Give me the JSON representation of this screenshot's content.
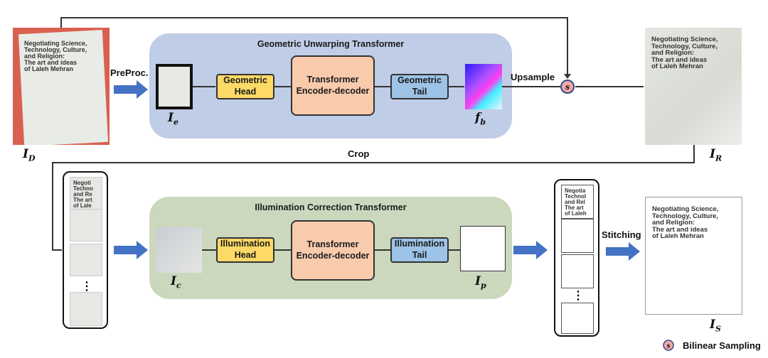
{
  "figure": {
    "geometric_panel": {
      "title": "Geometric Unwarping Transformer",
      "head": "Geometric\nHead",
      "encoder": "Transformer\nEncoder-decoder",
      "tail": "Geometric\nTail",
      "input_label": "I",
      "input_sub": "e",
      "output_label": "f",
      "output_sub": "b",
      "color": "#c0cde6"
    },
    "illumination_panel": {
      "title": "Illumination Correction Transformer",
      "head": "Illumination\nHead",
      "encoder": "Transformer\nEncoder-decoder",
      "tail": "Illumination\nTail",
      "input_label": "I",
      "input_sub": "c",
      "output_label": "I",
      "output_sub": "p",
      "color": "#cbd8be"
    },
    "steps": {
      "preproc": "PreProc.",
      "upsample": "Upsample",
      "crop": "Crop",
      "stitching": "Stitching"
    },
    "images": {
      "distorted": {
        "label": "I",
        "sub": "D",
        "title": "Negotiating Science,\nTechnology, Culture,\nand Religion:\nThe art and ideas\nof Laleh Mehran"
      },
      "rectified": {
        "label": "I",
        "sub": "R",
        "title": "Negotiating Science,\nTechnology, Culture,\nand Religion:\nThe art and ideas\nof Laleh Mehran"
      },
      "stitched": {
        "label": "I",
        "sub": "S",
        "title": "Negotiating Science,\nTechnology, Culture,\nand Religion:\nThe art and ideas\nof Laleh Mehran"
      },
      "crop_tile_title": "Negoti\nTechno\nand Re\nThe art\nof Lale",
      "out_tile_title": "Negotia\nTechnol\nand Rel\nThe art\nof Laleh"
    },
    "sampler": {
      "symbol": "s",
      "fill": "#f4a7a7",
      "stroke": "#2e4e8a"
    },
    "legend": {
      "symbol": "s",
      "text": "Bilinear Sampling"
    },
    "ellipsis": "⋮",
    "arrow_color": "#4472c4",
    "block_colors": {
      "head": "#fdd966",
      "encoder": "#f8cbad",
      "tail": "#9dc3e6"
    }
  }
}
